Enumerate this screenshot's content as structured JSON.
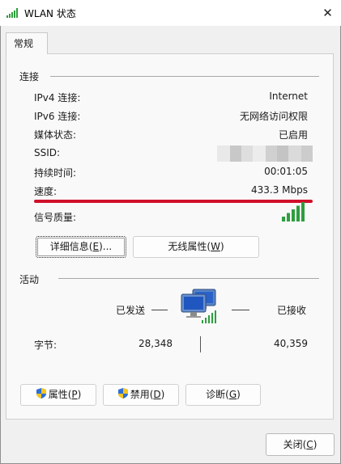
{
  "window": {
    "title": "WLAN 状态",
    "close_glyph": "✕"
  },
  "tab": {
    "label": "常规"
  },
  "connection": {
    "heading": "连接",
    "rows": [
      {
        "label": "IPv4 连接:",
        "value": "Internet"
      },
      {
        "label": "IPv6 连接:",
        "value": "无网络访问权限"
      },
      {
        "label": "媒体状态:",
        "value": "已启用"
      },
      {
        "label": "SSID:",
        "value": ""
      },
      {
        "label": "持续时间:",
        "value": "00:01:05"
      },
      {
        "label": "速度:",
        "value": "433.3 Mbps"
      }
    ],
    "signal_label": "信号质量:",
    "signal_bars": 5,
    "signal_bars_max": 5,
    "details_button": {
      "text": "详细信息(",
      "key": "E",
      "suffix": ")..."
    },
    "wireless_button": {
      "text": "无线属性(",
      "key": "W",
      "suffix": ")"
    }
  },
  "activity": {
    "heading": "活动",
    "sent_label": "已发送",
    "received_label": "已接收",
    "bytes_label": "字节:",
    "bytes_sent": "28,348",
    "bytes_received": "40,359"
  },
  "actions": {
    "properties": {
      "text": "属性(",
      "key": "P",
      "suffix": ")"
    },
    "disable": {
      "text": "禁用(",
      "key": "D",
      "suffix": ")"
    },
    "diagnose": {
      "text": "诊断(",
      "key": "G",
      "suffix": ")"
    }
  },
  "footer": {
    "close": {
      "text": "关闭(",
      "key": "C",
      "suffix": ")"
    }
  },
  "colors": {
    "signal_green": "#2e9e3e",
    "underline_red": "#d0102a",
    "shield_blue": "#2f6fd6",
    "shield_yellow": "#f3c623"
  },
  "icons": {
    "title": "wifi-signal-icon",
    "activity": "network-computers-icon",
    "shield": "uac-shield-icon"
  }
}
